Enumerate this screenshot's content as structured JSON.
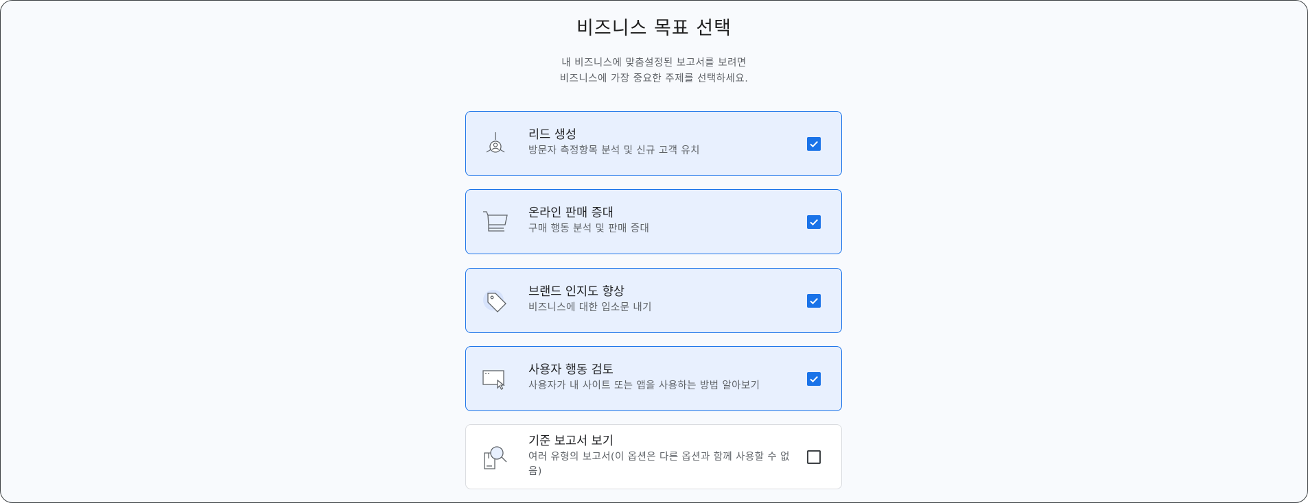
{
  "header": {
    "title": "비즈니스 목표 선택",
    "subtitle_line1": "내 비즈니스에 맞춤설정된 보고서를 보려면",
    "subtitle_line2": "비즈니스에 가장 중요한 주제를 선택하세요."
  },
  "options": [
    {
      "label": "리드 생성",
      "description": "방문자 측정항목 분석 및 신규 고객 유치",
      "icon": "lead-generation-icon",
      "checked": true
    },
    {
      "label": "온라인 판매 증대",
      "description": "구매 행동 분석 및 판매 증대",
      "icon": "shopping-cart-icon",
      "checked": true
    },
    {
      "label": "브랜드 인지도 향상",
      "description": "비즈니스에 대한 입소문 내기",
      "icon": "tag-icon",
      "checked": true
    },
    {
      "label": "사용자 행동 검토",
      "description": "사용자가 내 사이트 또는 앱을 사용하는 방법 알아보기",
      "icon": "screen-cursor-icon",
      "checked": true
    },
    {
      "label": "기준 보고서 보기",
      "description": "여러 유형의 보고서(이 옵션은 다른 옵션과 함께 사용할 수 없음)",
      "icon": "report-search-icon",
      "checked": false
    }
  ],
  "colors": {
    "accent": "#1a73e8",
    "selected_bg": "#e8f0fe",
    "page_bg": "#f8fafd"
  }
}
